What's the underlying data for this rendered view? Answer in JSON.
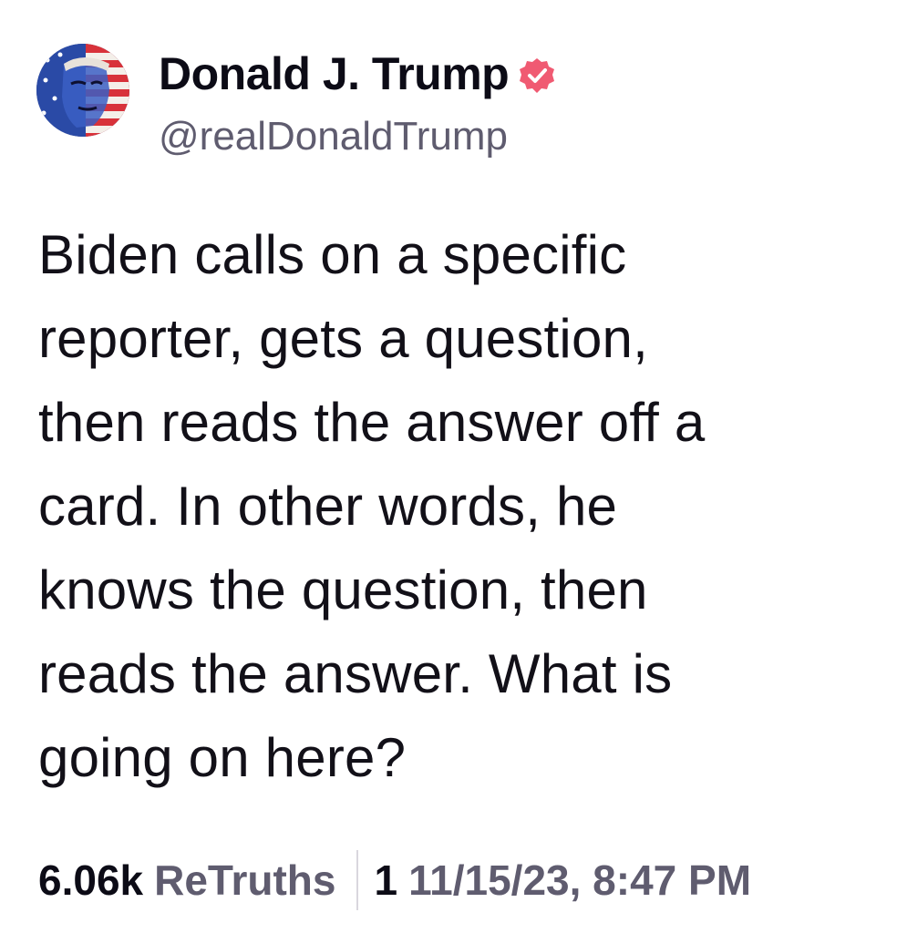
{
  "author": {
    "display_name": "Donald J. Trump",
    "handle": "@realDonaldTrump",
    "verified_icon": "verified-badge-icon",
    "badge_color": "#f05a72"
  },
  "post": {
    "lines": [
      "Biden calls on a specific",
      "reporter, gets a question,",
      "then reads the answer off a",
      "card. In other words, he",
      "knows the question, then",
      "reads the answer. What is",
      "going on here?"
    ]
  },
  "stats": {
    "retruths_count": "6.06k",
    "retruths_label": "ReTruths",
    "likes_count": "1",
    "timestamp": "11/15/23, 8:47 PM"
  }
}
